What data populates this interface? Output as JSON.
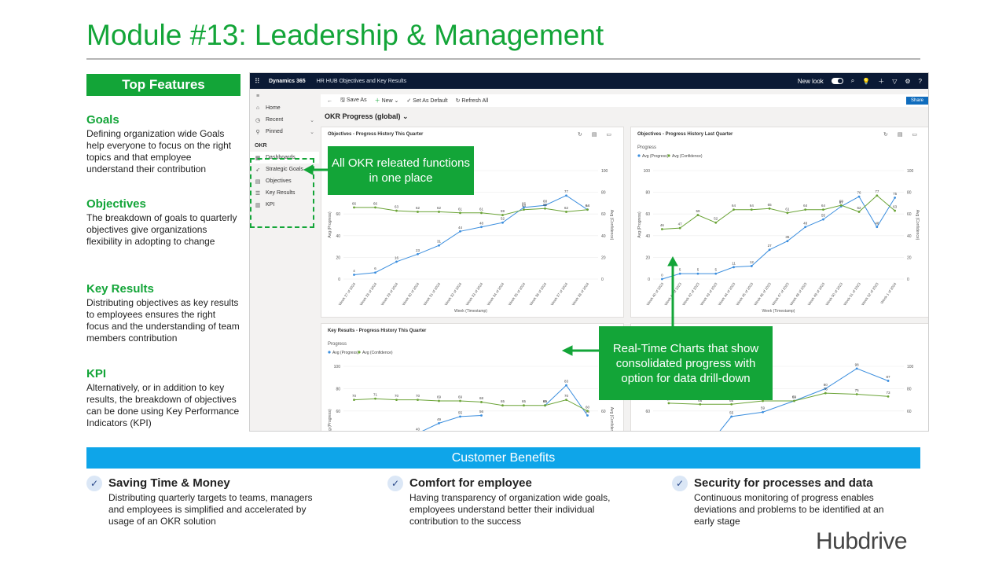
{
  "slide": {
    "title": "Module #13: Leadership & Management",
    "top_features_label": "Top Features",
    "logo_text": "Hubdrive"
  },
  "features": [
    {
      "title": "Goals",
      "text": "Defining organization wide Goals help everyone to focus on the right topics and that employee understand their contribution"
    },
    {
      "title": "Objectives",
      "text": "The breakdown of goals to quarterly objectives give organizations flexibility in adopting to change"
    },
    {
      "title": "Key Results",
      "text": "Distributing objectives as key results to employees ensures the right focus and the understanding of team members contribution"
    },
    {
      "title": "KPI",
      "text": "Alternatively, or in addition to key results, the breakdown of objectives can be done using Key Performance Indicators (KPI)"
    }
  ],
  "app": {
    "brand": "Dynamics 365",
    "crumb": "HR HUB Objectives and Key Results",
    "new_look_label": "New look",
    "sidebar": {
      "top_items": [
        {
          "label": "Home",
          "icon": "home-icon"
        },
        {
          "label": "Recent",
          "icon": "clock-icon"
        },
        {
          "label": "Pinned",
          "icon": "pin-icon"
        }
      ],
      "group_label": "OKR",
      "okr_items": [
        {
          "label": "Dashboards",
          "icon": "dashboard-icon"
        },
        {
          "label": "Strategic Goals",
          "icon": "rocket-icon"
        },
        {
          "label": "Objectives",
          "icon": "grid-icon"
        },
        {
          "label": "Key Results",
          "icon": "list-icon"
        },
        {
          "label": "KPI",
          "icon": "kpi-icon"
        }
      ]
    },
    "commands": {
      "save_as": "Save As",
      "new": "New",
      "set_default": "Set As Default",
      "refresh": "Refresh All",
      "share": "Share"
    },
    "dashboard_title": "OKR Progress (global)"
  },
  "callouts": {
    "okr": "All OKR releated functions in one place",
    "charts": "Real-Time Charts that show consolidated progress with option for data drill-down"
  },
  "benefits_title": "Customer Benefits",
  "benefits": [
    {
      "title": "Saving Time & Money",
      "text": "Distributing quarterly targets to teams, managers and employees is simplified and accelerated by usage of an OKR solution"
    },
    {
      "title": "Comfort for employee",
      "text": "Having transparency of organization wide goals, employees understand better their individual contribution to the success"
    },
    {
      "title": "Security for processes and data",
      "text": "Continuous monitoring of progress enables deviations and problems to be identified at an early stage"
    }
  ],
  "colors": {
    "green": "#13a538",
    "blue": "#0ea5e9",
    "progress_series": "#3b8ede",
    "confidence_series": "#6aa336"
  },
  "chart_data": [
    {
      "type": "line",
      "title": "Objectives - Progress History This Quarter",
      "xlabel": "Week (Timestamp)",
      "ylabel": "Avg (Progress)",
      "y2label": "Avg (Confidence)",
      "ylim": [
        0,
        100
      ],
      "y2lim": [
        0,
        100
      ],
      "x": [
        "Week 27 of 2024",
        "Week 28 of 2024",
        "Week 29 of 2024",
        "Week 30 of 2024",
        "Week 31 of 2024",
        "Week 32 of 2024",
        "Week 33 of 2024",
        "Week 34 of 2024",
        "Week 35 of 2024",
        "Week 36 of 2024",
        "Week 37 of 2024",
        "Week 38 of 2024"
      ],
      "series": [
        {
          "name": "Avg (Progress)",
          "values": [
            4,
            6,
            16,
            23,
            31,
            44,
            48,
            52,
            66,
            68,
            77,
            64
          ]
        },
        {
          "name": "Avg (Confidence)",
          "values": [
            66,
            66,
            63,
            62,
            62,
            61,
            61,
            59,
            64,
            65,
            62,
            64
          ]
        }
      ]
    },
    {
      "type": "line",
      "title": "Objectives - Progress History Last Quarter",
      "subtitle": "Progress",
      "xlabel": "Week (Timestamp)",
      "ylabel": "Avg (Progress)",
      "y2label": "Avg (Confidence)",
      "ylim": [
        0,
        100
      ],
      "y2lim": [
        0,
        100
      ],
      "x": [
        "Week 40 of 2023",
        "Week 41 of 2023",
        "Week 42 of 2023",
        "Week 43 of 2023",
        "Week 44 of 2023",
        "Week 45 of 2023",
        "Week 46 of 2023",
        "Week 47 of 2023",
        "Week 48 of 2023",
        "Week 49 of 2023",
        "Week 50 of 2023",
        "Week 51 of 2023",
        "Week 52 of 2023",
        "Week 1 of 2024"
      ],
      "series": [
        {
          "name": "Avg (Progress)",
          "values": [
            0,
            5,
            5,
            5,
            11,
            12,
            27,
            35,
            48,
            55,
            67,
            76,
            48,
            75
          ]
        },
        {
          "name": "Avg (Confidence)",
          "values": [
            46,
            47,
            59,
            52,
            64,
            64,
            65,
            61,
            64,
            64,
            68,
            62,
            77,
            63
          ]
        }
      ]
    },
    {
      "type": "line",
      "title": "Key Results - Progress History This Quarter",
      "subtitle": "Progress",
      "ylim": [
        0,
        100
      ],
      "y2lim": [
        0,
        100
      ],
      "ylabel": "Avg (Progress)",
      "y2label": "Avg (Confidence)",
      "series": [
        {
          "name": "Avg (Progress)",
          "values": [
            null,
            null,
            null,
            40,
            49,
            55,
            56,
            null,
            null,
            65,
            83,
            56
          ]
        },
        {
          "name": "Avg (Confidence)",
          "values": [
            70,
            71,
            70,
            70,
            69,
            69,
            68,
            65,
            65,
            65,
            70,
            60
          ]
        }
      ]
    },
    {
      "type": "line",
      "title": "",
      "ylim": [
        0,
        100
      ],
      "series": [
        {
          "name": "Avg (Progress)",
          "values": [
            20,
            20,
            55,
            59,
            69,
            80,
            98,
            87
          ]
        },
        {
          "name": "Avg (Confidence)",
          "values": [
            67,
            66,
            66,
            69,
            69,
            76,
            75,
            73
          ]
        }
      ]
    }
  ]
}
